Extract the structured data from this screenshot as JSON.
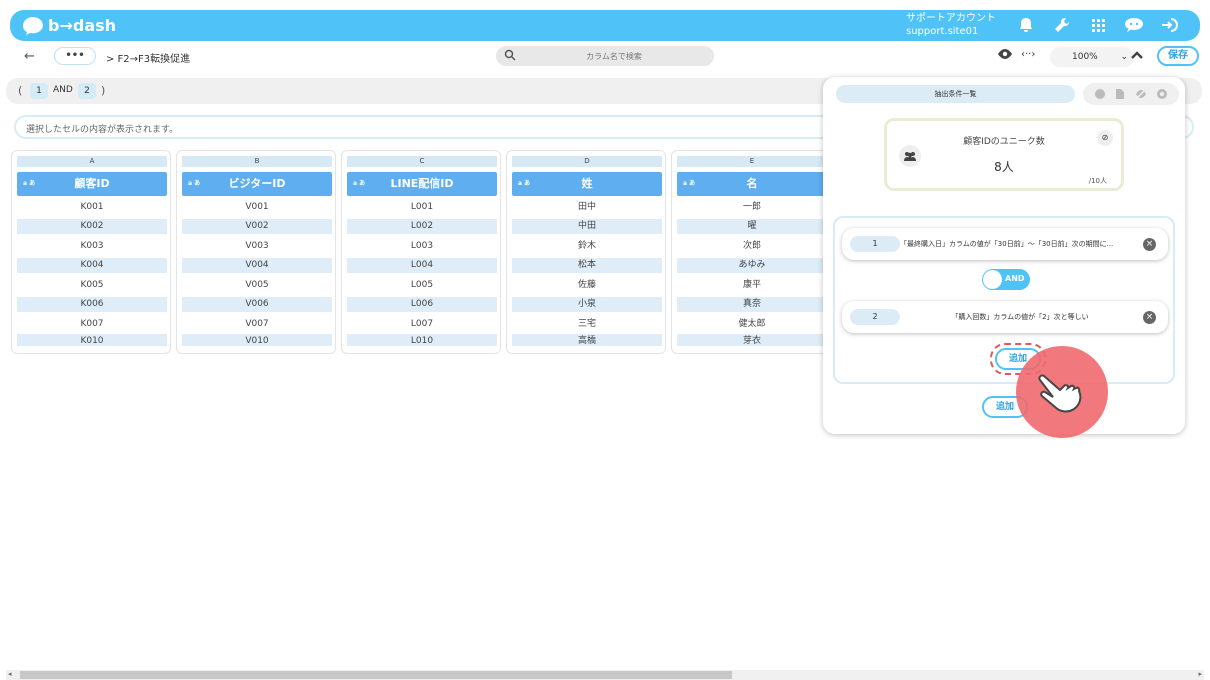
{
  "app": {
    "name": "b→dash"
  },
  "header": {
    "support_label": "サポートアカウント",
    "site": "support.site01"
  },
  "toolbar": {
    "dots": "•••",
    "breadcrumb": "> F2→F3転換促進",
    "search_placeholder": "カラム名で検索",
    "swap": "‹··›",
    "zoom": "100%",
    "save": "保存"
  },
  "conditions_bar": {
    "open": "(",
    "chip1": "1",
    "and": "AND",
    "chip2": "2",
    "close": ")"
  },
  "cell_display": {
    "placeholder": "選択したセルの内容が表示されます。"
  },
  "columns": [
    {
      "letter": "A",
      "tag": "a あ",
      "name": "顧客ID",
      "values": [
        "K001",
        "K002",
        "K003",
        "K004",
        "K005",
        "K006",
        "K007",
        "K010"
      ]
    },
    {
      "letter": "B",
      "tag": "a あ",
      "name": "ビジターID",
      "values": [
        "V001",
        "V002",
        "V003",
        "V004",
        "V005",
        "V006",
        "V007",
        "V010"
      ]
    },
    {
      "letter": "C",
      "tag": "a あ",
      "name": "LINE配信ID",
      "values": [
        "L001",
        "L002",
        "L003",
        "L004",
        "L005",
        "L006",
        "L007",
        "L010"
      ]
    },
    {
      "letter": "D",
      "tag": "a あ",
      "name": "姓",
      "values": [
        "田中",
        "中田",
        "鈴木",
        "松本",
        "佐藤",
        "小泉",
        "三宅",
        "高橋"
      ]
    },
    {
      "letter": "E",
      "tag": "a あ",
      "name": "名",
      "values": [
        "一郎",
        "曜",
        "次郎",
        "あゆみ",
        "康平",
        "真奈",
        "健太郎",
        "芽衣"
      ]
    }
  ],
  "panel": {
    "tab": "抽出条件一覧",
    "card": {
      "title": "顧客IDのユニーク数",
      "count": "8人",
      "total": "/10人"
    },
    "conditions": [
      {
        "index": "1",
        "text": "「最終購入日」カラムの値が「30日前」～「30日前」次の期間に..."
      },
      {
        "index": "2",
        "text": "「購入回数」カラムの値が「2」次と等しい"
      }
    ],
    "toggle": "AND",
    "add_inner": "追加",
    "add_outer": "追加"
  },
  "colors": {
    "accent": "#4fc3f7",
    "header_col": "#5eaef0",
    "highlight": "#f06a6e"
  }
}
